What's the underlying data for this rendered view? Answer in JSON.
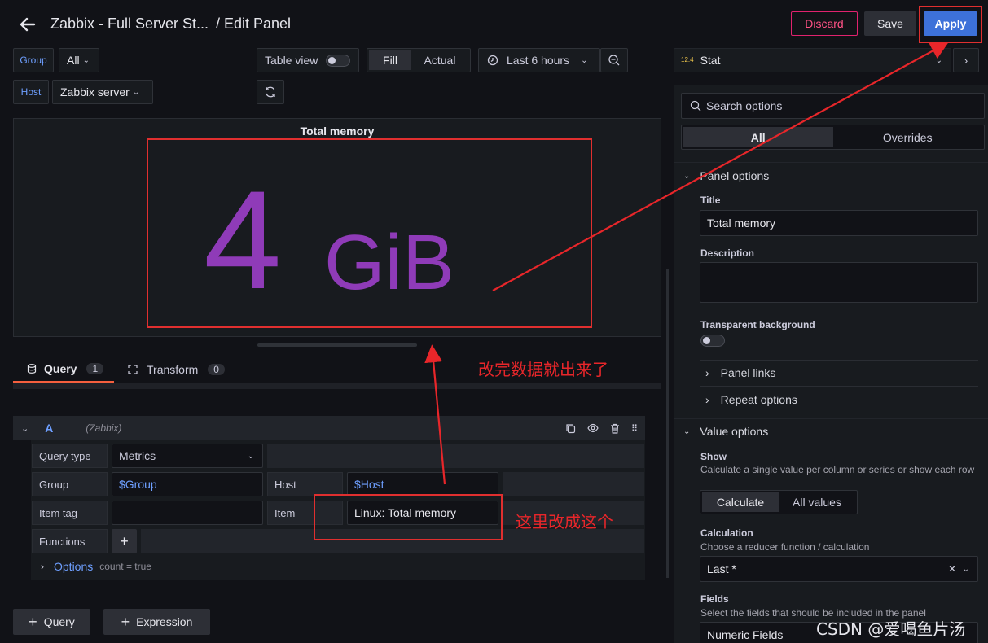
{
  "header": {
    "title": "Zabbix - Full Server St...",
    "subtitle": "/ Edit Panel",
    "discard": "Discard",
    "save": "Save",
    "apply": "Apply"
  },
  "vars": {
    "group_label": "Group",
    "group_value": "All",
    "host_label": "Host",
    "host_value": "Zabbix server"
  },
  "toolbar": {
    "table_view": "Table view",
    "fill": "Fill",
    "actual": "Actual",
    "time_range": "Last 6 hours"
  },
  "panel": {
    "title": "Total memory",
    "value": "4",
    "unit": "GiB",
    "value_color": "#8f3bb8"
  },
  "tabs": {
    "query": "Query",
    "query_count": "1",
    "transform": "Transform",
    "transform_count": "0"
  },
  "query": {
    "ref": "A",
    "datasource": "(Zabbix)",
    "query_type_label": "Query type",
    "query_type_value": "Metrics",
    "group_label": "Group",
    "group_value": "$Group",
    "host_label": "Host",
    "host_value": "$Host",
    "item_tag_label": "Item tag",
    "item_label": "Item",
    "item_value": "Linux: Total memory",
    "functions_label": "Functions",
    "options_label": "Options",
    "options_summary": "count = true",
    "add_query": "Query",
    "add_expression": "Expression"
  },
  "right": {
    "viz_name": "Stat",
    "viz_badge": "12.4",
    "search_placeholder": "Search options",
    "tab_all": "All",
    "tab_overrides": "Overrides",
    "panel_options": "Panel options",
    "title_label": "Title",
    "title_value": "Total memory",
    "description_label": "Description",
    "transparent_label": "Transparent background",
    "panel_links": "Panel links",
    "repeat_options": "Repeat options",
    "value_options": "Value options",
    "show_label": "Show",
    "show_desc": "Calculate a single value per column or series or show each row",
    "calculate": "Calculate",
    "all_values": "All values",
    "calculation_label": "Calculation",
    "calculation_desc": "Choose a reducer function / calculation",
    "calculation_value": "Last *",
    "fields_label": "Fields",
    "fields_desc": "Select the fields that should be included in the panel",
    "fields_value": "Numeric Fields"
  },
  "annotations": {
    "note1": "改完数据就出来了",
    "note2": "这里改成这个",
    "watermark": "CSDN @爱喝鱼片汤"
  }
}
